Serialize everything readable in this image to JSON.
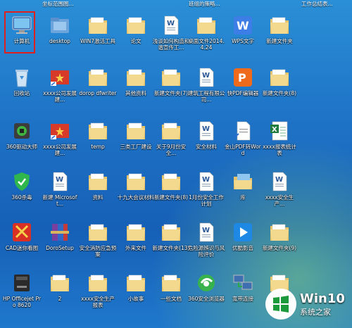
{
  "top_partial_labels": [
    "坐标范围图...",
    "班组的策略...",
    "工作总结表..."
  ],
  "rows": [
    [
      {
        "label": "计算机",
        "icon": "computer-icon"
      },
      {
        "label": "desktop",
        "icon": "folder-blue-icon"
      },
      {
        "label": "WIN7激活工具",
        "icon": "folder-icon"
      },
      {
        "label": "论文",
        "icon": "folder-icon"
      },
      {
        "label": "浅谈如何构造和谐宣传工...",
        "icon": "word-doc-icon"
      },
      {
        "label": "桌面文件2014.4.24",
        "icon": "folder-icon"
      },
      {
        "label": "WPS文字",
        "icon": "wps-writer-icon"
      },
      {
        "label": "新建文件夹",
        "icon": "folder-icon"
      }
    ],
    [
      {
        "label": "回收站",
        "icon": "recycle-bin-icon"
      },
      {
        "label": "xxxx公司发展建...",
        "icon": "shortcut-doc-icon"
      },
      {
        "label": "dorop dfwriter",
        "icon": "folder-icon"
      },
      {
        "label": "其他资料",
        "icon": "folder-icon"
      },
      {
        "label": "新建文件夹(7)",
        "icon": "folder-icon"
      },
      {
        "label": "建筑工程有限公司...",
        "icon": "word-doc-icon"
      },
      {
        "label": "快PDF编辑器",
        "icon": "pdf-editor-icon"
      },
      {
        "label": "新建文件夹(8)",
        "icon": "folder-icon"
      }
    ],
    [
      {
        "label": "360驱动大师",
        "icon": "driver-master-icon"
      },
      {
        "label": "xxxx公司发展建...",
        "icon": "shortcut-doc-icon"
      },
      {
        "label": "temp",
        "icon": "folder-icon"
      },
      {
        "label": "三类工厂建设",
        "icon": "folder-icon"
      },
      {
        "label": "关于9月份安全...",
        "icon": "folder-icon"
      },
      {
        "label": "安全材料",
        "icon": "word-doc-icon"
      },
      {
        "label": "金山PDF转Word",
        "icon": "pdf-to-word-icon"
      },
      {
        "label": "xxxx报表统计表",
        "icon": "excel-icon"
      }
    ],
    [
      {
        "label": "360杀毒",
        "icon": "antivirus-shield-icon"
      },
      {
        "label": "新建 Microsoft...",
        "icon": "word-doc-icon"
      },
      {
        "label": "资料",
        "icon": "folder-icon"
      },
      {
        "label": "十九大会议材料",
        "icon": "folder-icon"
      },
      {
        "label": "新建文件夹(8)",
        "icon": "folder-icon"
      },
      {
        "label": "1月份安全工作计划",
        "icon": "word-doc-icon"
      },
      {
        "label": "库",
        "icon": "library-folder-icon"
      },
      {
        "label": "xxxx安全生产...",
        "icon": "word-doc-icon"
      }
    ],
    [
      {
        "label": "CAD迷你看图",
        "icon": "cad-viewer-icon"
      },
      {
        "label": "DoroSetup",
        "icon": "winrar-archive-icon"
      },
      {
        "label": "安全消防应急预案",
        "icon": "folder-icon"
      },
      {
        "label": "外来文件",
        "icon": "folder-icon"
      },
      {
        "label": "新建文件夹(13)",
        "icon": "folder-icon"
      },
      {
        "label": "危险源辨识与风险评价",
        "icon": "word-doc-icon"
      },
      {
        "label": "优酷影音",
        "icon": "video-player-icon"
      },
      {
        "label": "新建文件夹(9)",
        "icon": "folder-icon"
      }
    ],
    [
      {
        "label": "HP Officejet Pro 8620",
        "icon": "printer-icon"
      },
      {
        "label": "2",
        "icon": "folder-icon"
      },
      {
        "label": "xxxx安全生产报表",
        "icon": "folder-icon"
      },
      {
        "label": "小故事",
        "icon": "folder-icon"
      },
      {
        "label": "一些文档",
        "icon": "folder-icon"
      },
      {
        "label": "360安全浏览器",
        "icon": "browser-icon"
      },
      {
        "label": "宽带连接",
        "icon": "network-icon"
      },
      {
        "label": "",
        "icon": "folder-icon"
      }
    ]
  ],
  "watermark": {
    "title": "Win10",
    "subtitle": "系统之家"
  }
}
